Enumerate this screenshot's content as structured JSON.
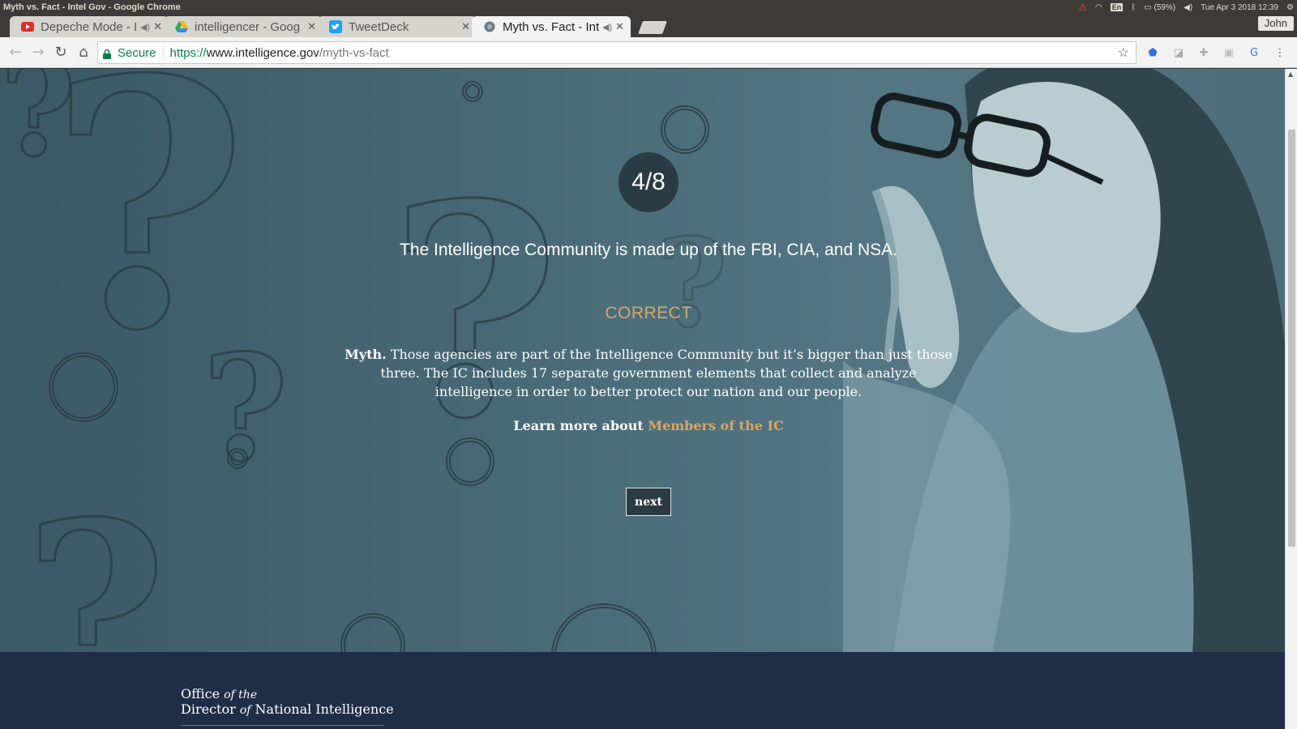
{
  "window": {
    "title": "Myth vs. Fact - Intel Gov - Google Chrome"
  },
  "system": {
    "lang": "En",
    "battery": "(59%)",
    "datetime": "Tue Apr 3 2018 12:39"
  },
  "tabs": [
    {
      "label": "Depeche Mode - I",
      "favicon": "youtube-icon",
      "muted": true
    },
    {
      "label": "intelligencer - Goog",
      "favicon": "drive-icon",
      "muted": false
    },
    {
      "label": "TweetDeck",
      "favicon": "twitter-icon",
      "muted": false
    },
    {
      "label": "Myth vs. Fact - Int",
      "favicon": "globe-icon",
      "muted": true,
      "active": true
    }
  ],
  "profile": {
    "name": "John"
  },
  "address": {
    "secure_label": "Secure",
    "scheme": "https://",
    "host": "www.intelligence.gov",
    "path": "/myth-vs-fact"
  },
  "quiz": {
    "counter": "4/8",
    "statement": "The Intelligence Community is made up of the FBI, CIA, and NSA.",
    "verdict": "CORRECT",
    "answer_lead": "Myth.",
    "answer_body": " Those agencies are part of the Intelligence Community but it’s bigger than just those three. The IC includes 17 separate government elements that collect and analyze intelligence in order to better protect our nation and our people.",
    "learn_prefix": "Learn more about ",
    "learn_link": "Members of the IC",
    "next_label": "next"
  },
  "footer": {
    "logo_line1_a": "Office ",
    "logo_line1_b": "of the",
    "logo_line2_a": "Director ",
    "logo_line2_b": "of",
    "logo_line2_c": " National Intelligence"
  },
  "colors": {
    "accent": "#d8a864",
    "hero": "#4a6b78",
    "footer": "#1f2d47",
    "counter_bg": "#2b3b43"
  }
}
